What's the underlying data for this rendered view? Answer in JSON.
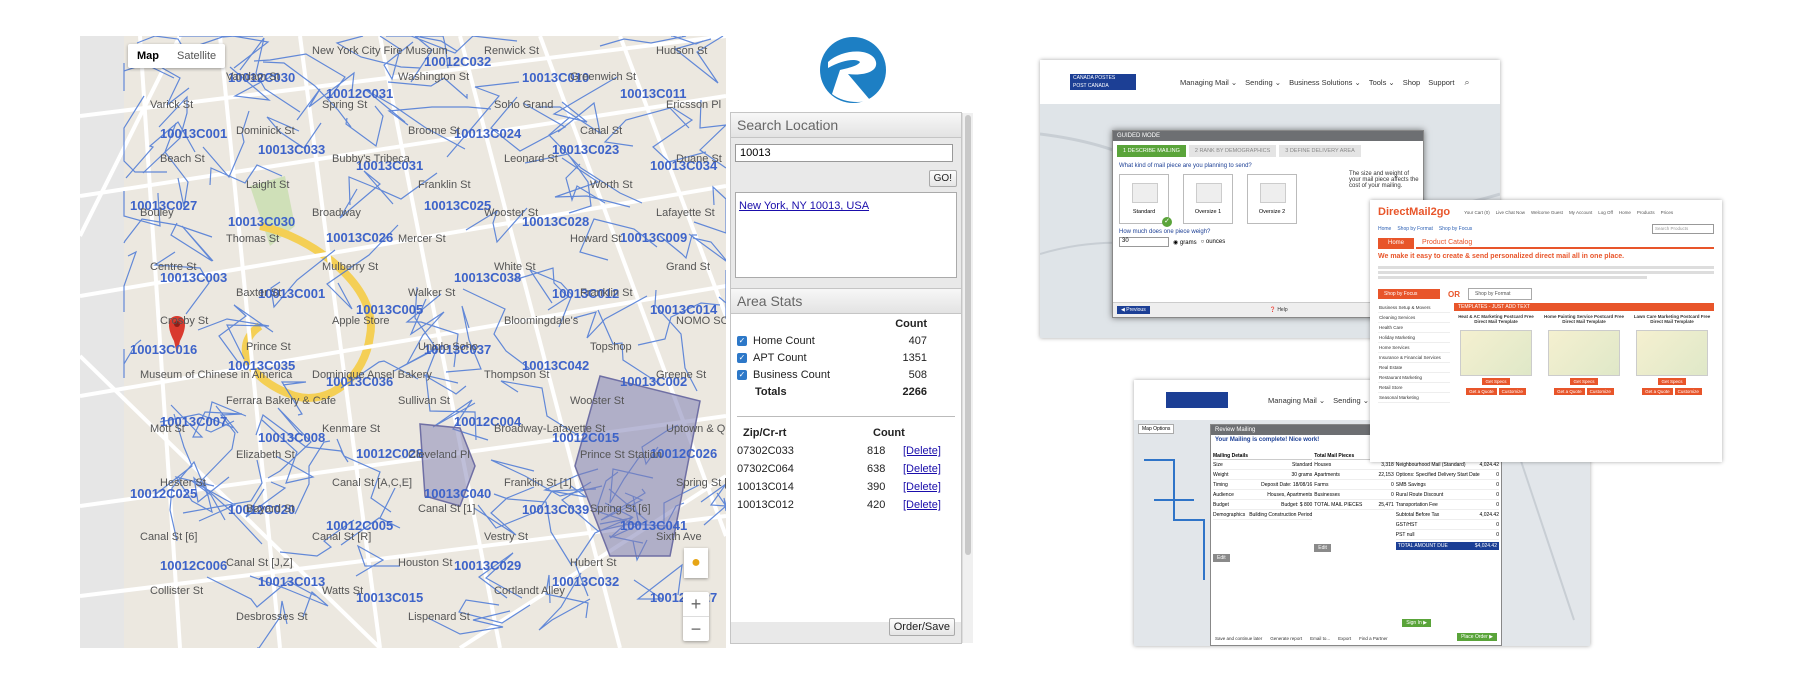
{
  "map": {
    "toggle": {
      "map": "Map",
      "satellite": "Satellite"
    },
    "streets": [
      "Charlton St",
      "Vandam St",
      "New York City Fire Museum",
      "Washington St",
      "Renwick St",
      "Greenwich St",
      "Hudson St",
      "Varick St",
      "Dominick St",
      "Spring St",
      "Broome St",
      "Soho Grand",
      "Canal St",
      "Ericsson Pl",
      "Beach St",
      "Laight St",
      "Bubby's Tribeca",
      "Franklin St",
      "Leonard St",
      "Worth St",
      "Duane St",
      "Bouley",
      "Thomas St",
      "Broadway",
      "Mercer St",
      "Wooster St",
      "Howard St",
      "Lafayette St",
      "Centre St",
      "Baxter St",
      "Mulberry St",
      "Walker St",
      "White St",
      "Franklin St",
      "Grand St",
      "Crosby St",
      "Prince St",
      "Apple Store",
      "Uniqlo Soho",
      "Bloomingdale's",
      "Topshop",
      "NOMO SOHO",
      "Museum of Chinese in America",
      "Ferrara Bakery & Cafe",
      "Dominique Ansel Bakery",
      "Sullivan St",
      "Thompson St",
      "Wooster St",
      "Greene St",
      "Mott St",
      "Elizabeth St",
      "Kenmare St",
      "Cleveland Pl",
      "Broadway-Lafayette St",
      "Prince St Station",
      "Uptown & Queens",
      "Hester St",
      "Bayard St",
      "Canal St [A,C,E]",
      "Canal St [1]",
      "Franklin St [1]",
      "Spring St [6]",
      "Spring St [C,E]",
      "Canal St [6]",
      "Canal St [J,Z]",
      "Canal St [R]",
      "Houston St",
      "Vestry St",
      "Hubert St",
      "Sixth Ave",
      "Collister St",
      "Desbrosses St",
      "Watts St",
      "Lispenard St",
      "Cortlandt Alley"
    ],
    "zip_labels": [
      "10012C029",
      "10012C030",
      "10012C031",
      "10012C032",
      "10013C010",
      "10013C011",
      "10013C001",
      "10013C033",
      "10013C031",
      "10013C024",
      "10013C023",
      "10013C034",
      "10013C027",
      "10013C030",
      "10013C026",
      "10013C025",
      "10013C028",
      "10013C009",
      "10013C003",
      "10013C001",
      "10013C005",
      "10013C038",
      "10013C012",
      "10013C014",
      "10013C016",
      "10013C035",
      "10013C036",
      "10013C037",
      "10013C042",
      "10013C002",
      "10013C007",
      "10013C008",
      "10012C028",
      "10012C004",
      "10012C015",
      "10012C026",
      "10012C025",
      "10012C020",
      "10012C005",
      "10013C040",
      "10013C039",
      "10013C041",
      "10012C006",
      "10013C013",
      "10013C015",
      "10013C029",
      "10013C032",
      "10012C027"
    ]
  },
  "logo": {
    "name": "logo-r"
  },
  "search": {
    "title": "Search Location",
    "query": "10013",
    "go_label": "GO!",
    "result_link": "New York, NY 10013, USA"
  },
  "area_stats": {
    "title": "Area Stats",
    "count_header": "Count",
    "rows": [
      {
        "label": "Home Count",
        "value": "407"
      },
      {
        "label": "APT Count",
        "value": "1351"
      },
      {
        "label": "Business Count",
        "value": "508"
      }
    ],
    "totals_label": "Totals",
    "totals_value": "2266",
    "table_headers": {
      "zip": "Zip/Cr-rt",
      "count": "Count"
    },
    "table": [
      {
        "zip": "07302C033",
        "count": "818",
        "action": "[Delete]"
      },
      {
        "zip": "07302C064",
        "count": "638",
        "action": "[Delete]"
      },
      {
        "zip": "10013C014",
        "count": "390",
        "action": "[Delete]"
      },
      {
        "zip": "10013C012",
        "count": "420",
        "action": "[Delete]"
      }
    ],
    "order_label": "Order/Save"
  },
  "canada_post_top": {
    "brand_line1": "CANADA POSTES",
    "brand_line2": "POST CANADA",
    "nav": [
      "Managing Mail ⌄",
      "Sending ⌄",
      "Business Solutions ⌄",
      "Tools ⌄",
      "Shop",
      "Support"
    ],
    "dialog_title": "GUIDED MODE",
    "steps": [
      "1  DESCRIBE MAILING",
      "2  RANK BY DEMOGRAPHICS",
      "3  DEFINE DELIVERY AREA"
    ],
    "question": "What kind of mail piece are you planning to send?",
    "options": [
      "Standard",
      "Oversize 1",
      "Oversize 2"
    ],
    "side_note": "The size and weight of your mail piece affects the cost of your mailing.",
    "weight_question": "How much does one piece weigh?",
    "weight_value": "30",
    "units": [
      "grams",
      "ounces"
    ],
    "prev_label": "◀ Previous",
    "help_label": "Help"
  },
  "direct_mail": {
    "brand": "DirectMail2go",
    "top_links": [
      "Your Cart (0)",
      "Live Chat Now",
      "Welcome Guest",
      "My Account",
      "Log Off",
      "Home",
      "Products",
      "Prices"
    ],
    "nav": [
      "Home",
      "Shop by Format",
      "Shop by Focus"
    ],
    "search_placeholder": "Search Products",
    "tab_home": "Home",
    "tab_catalog": "Product Catalog",
    "headline": "We make it easy to create & send personalized direct mail all in one place.",
    "shop_focus": "Shop by Focus",
    "or_label": "OR",
    "shop_format": "Shop by Format",
    "categories": [
      "Business Setup & Movers",
      "Cleaning Services",
      "Health Care",
      "Holiday Marketing",
      "Home Services",
      "Insurance & Financial Services",
      "Real Estate",
      "Restaurant Marketing",
      "Retail Store",
      "Seasonal Marketing"
    ],
    "banner": "TEMPLATES - JUST ADD TEXT",
    "products": [
      {
        "title": "Heat & AC Marketing Postcard Free Direct Mail Template",
        "btn": "Get Specs",
        "btn2": "Get a Quote",
        "btn3": "Customize"
      },
      {
        "title": "Home Painting Service Postcard Free Direct Mail Template",
        "btn": "Get Specs",
        "btn2": "Get a Quote",
        "btn3": "Customize"
      },
      {
        "title": "Lawn Care Marketing Postcard Free Direct Mail Template",
        "btn": "Get Specs",
        "btn2": "Get a Quote",
        "btn3": "Customize"
      }
    ]
  },
  "canada_post_bottom": {
    "nav": [
      "Managing Mail ⌄",
      "Sending ⌄"
    ],
    "map_options": "Map Options",
    "dialog_title": "Review Mailing",
    "complete": "Your Mailing is complete! Nice work!",
    "sections": [
      "Mailing Details",
      "Total Mail Pieces",
      "Estimated Delivery Cost"
    ],
    "details": [
      {
        "k": "Size",
        "v": "Standard"
      },
      {
        "k": "Weight",
        "v": "30 grams"
      },
      {
        "k": "Timing",
        "v": "Deposit Date: 18/08/16"
      },
      {
        "k": "Audience",
        "v": "Houses, Apartments"
      },
      {
        "k": "Budget",
        "v": "Budget: $ 800"
      },
      {
        "k": "Demographics",
        "v": "Building Construction Period"
      }
    ],
    "pieces": [
      {
        "k": "Houses",
        "v": "3,318"
      },
      {
        "k": "Apartments",
        "v": "22,153"
      },
      {
        "k": "Farms",
        "v": "0"
      },
      {
        "k": "Businesses",
        "v": "0"
      },
      {
        "k": "TOTAL MAIL PIECES",
        "v": "25,471"
      }
    ],
    "costs": [
      {
        "k": "Neighbourhood Mail (Standard)",
        "v": "4,024.42"
      },
      {
        "k": "Options: Specified Delivery Start Date",
        "v": "0"
      },
      {
        "k": "SMB Savings",
        "v": "0"
      },
      {
        "k": "Rural Route Discount",
        "v": "0"
      },
      {
        "k": "Transportation Fee",
        "v": "0"
      },
      {
        "k": "Subtotal Before Tax",
        "v": "4,024.42"
      },
      {
        "k": "GST/HST",
        "v": "0"
      },
      {
        "k": "PST null",
        "v": "0"
      }
    ],
    "total_label": "TOTAL AMOUNT DUE",
    "total_value": "$4,024.42",
    "edit": "Edit",
    "sign_in": "Sign In ▶",
    "place_order": "Place Order ▶",
    "footer": [
      "Save and continue later",
      "Generate report",
      "Email to...",
      "Export",
      "Find a Partner"
    ]
  },
  "colors": {
    "map_route": "#4a78d6",
    "selection": "#7f7fb4",
    "accent_orange": "#e8552a",
    "cp_red": "#d6202a",
    "cp_blue": "#1c3f95",
    "green": "#5aa43a",
    "logo_blue": "#1d7fc4"
  }
}
